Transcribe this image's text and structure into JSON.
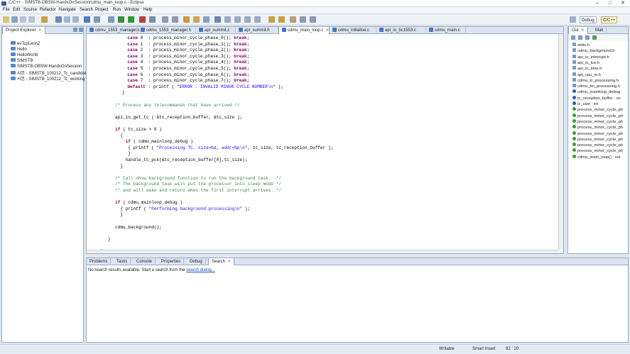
{
  "window": {
    "title": "C/C++ - SIMSTB-OBSW-HandsOnSession/cdmu_main_loop.c - Eclipse"
  },
  "menu": [
    "File",
    "Edit",
    "Source",
    "Refactor",
    "Navigate",
    "Search",
    "Project",
    "Run",
    "Window",
    "Help"
  ],
  "perspectives": {
    "debug": "Debug",
    "cpp": "C/C++"
  },
  "project_explorer": {
    "title": "Project Explorer",
    "items": [
      "evTcpLeon2",
      "Hello",
      "HelloWorld",
      "SIMSTB",
      "SIMSTB-OBSW-HandsOnSession",
      "사본 - SIMSTB_100212_Tc_candidate1",
      "사본 - SIMSTB_100212_Tc_working"
    ]
  },
  "editor": {
    "tabs": [
      "cdmu_1553_manager.c",
      "cdmu_1553_manager.h",
      "api_summit.c",
      "api_summit.h",
      "cdmu_main_loop.c",
      "cdmu_initialise.c",
      "api_io_bc1553.c",
      "cdmu_main.c"
    ],
    "active_tab": "cdmu_main_loop.c",
    "code_lines": [
      "  case 0  : process_minor_cycle_phase_0(); break;",
      "  case 1  : process_minor_cycle_phase_1(); break;",
      "  case 2  : process_minor_cycle_phase_2(); break;",
      "  case 3  : process_minor_cycle_phase_3(); break;",
      "  case 4  : process_minor_cycle_phase_4(); break;",
      "  case 5  : process_minor_cycle_phase_5(); break;",
      "  case 6  : process_minor_cycle_phase_6(); break;",
      "  case 7  : process_minor_cycle_phase_7(); break;",
      "  default : printf ( \"ERROR : INVALID MINOR CYCLE NUMBER\\n\" );",
      "}",
      "",
      "/* Process any telecommands that have arrived */",
      "",
      "api_io_get_tc ( &tc_reception_buffer, &tc_size );",
      "",
      "if ( tc_size > 0 )",
      "  {",
      "    if ( cdmu_mainloop_debug )",
      "     { printf ( \"Processing TC, size=%d, addr=%p\\n\", tc_size, tc_reception_buffer );",
      "     }",
      "    handle_tc_pck(&tc_reception_buffer[0],tc_size);",
      "  }",
      "",
      "/* Call obsw background function to run the background task.  */",
      "/* The background task will put the processor into sleep mode */",
      "/* and will wake and return when the first interrupt arrives. */",
      "",
      "if ( cdmu_mainloop_debug )",
      "  { printf ( \"Performing background processing\\n\" );",
      "  }",
      "",
      "cdmu_background();",
      "",
      "}",
      "",
      "}",
      "",
      "}"
    ]
  },
  "outline": {
    "tabs": [
      "Out",
      "Mak"
    ],
    "items": [
      "stdio.h",
      "cdmu_background.h",
      "api_io_interrupt.h",
      "api_io_tce.h",
      "api_io_time.h",
      "api_cpu_io.h",
      "cdmu_tc_processing.h",
      "cdmu_tm_processing.h",
      "cdmu_mainloop_debug",
      "tc_reception_buffer : un",
      "tc_size : int",
      "process_minor_cycle_ph",
      "process_minor_cycle_ph",
      "process_minor_cycle_ph",
      "process_minor_cycle_ph",
      "process_minor_cycle_ph",
      "process_minor_cycle_ph",
      "process_minor_cycle_ph",
      "process_minor_cycle_ph",
      "cdmu_main_loop() : voi"
    ]
  },
  "bottom_panel": {
    "tabs": [
      "Problems",
      "Tasks",
      "Console",
      "Properties",
      "Debug",
      "Search"
    ],
    "active_tab": "Search",
    "message_prefix": "No search results available. Start a search from the",
    "message_link": "search dialog..."
  },
  "status": {
    "mode": "Writable",
    "insert": "Smart Insert",
    "position": "92 : 20"
  }
}
